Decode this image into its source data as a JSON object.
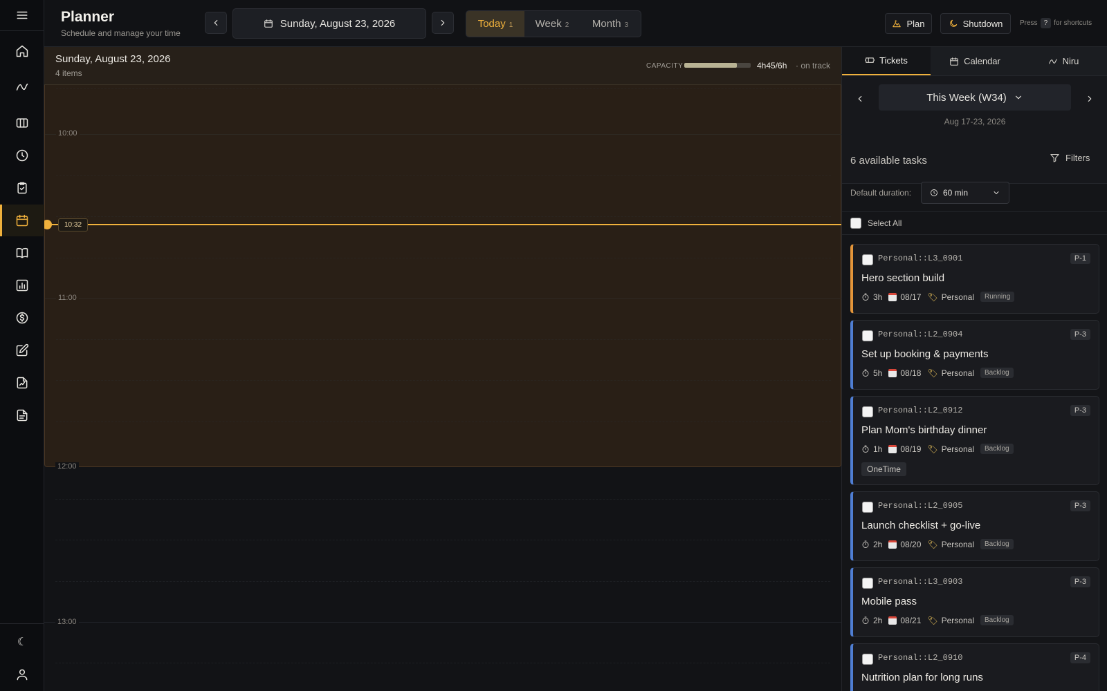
{
  "header": {
    "title": "Planner",
    "subtitle": "Schedule and manage your time",
    "current_date": "Sunday, August 23, 2026",
    "view_tabs": [
      {
        "label": "Today",
        "key": "1"
      },
      {
        "label": "Week",
        "key": "2"
      },
      {
        "label": "Month",
        "key": "3"
      }
    ],
    "plan_label": "Plan",
    "shutdown_label": "Shutdown",
    "hint_press": "Press",
    "hint_key": "?",
    "hint_suffix": "for shortcuts"
  },
  "sidebar": {
    "items": [
      {
        "icon": "home-icon"
      },
      {
        "icon": "activity-icon"
      },
      {
        "icon": "board-icon"
      },
      {
        "icon": "clock-icon"
      },
      {
        "icon": "clipboard-check-icon"
      },
      {
        "icon": "calendar-icon",
        "active": true
      },
      {
        "icon": "book-icon"
      },
      {
        "icon": "chart-icon"
      },
      {
        "icon": "dollar-icon"
      },
      {
        "icon": "edit-icon"
      },
      {
        "icon": "file-chart-icon"
      },
      {
        "icon": "document-icon"
      }
    ],
    "bottom": [
      {
        "icon": "moon-icon"
      },
      {
        "icon": "user-icon"
      }
    ]
  },
  "calendar": {
    "date": "Sunday, August 23, 2026",
    "items_count": "4 items",
    "capacity_label": "CAPACITY",
    "capacity_fraction": 0.79,
    "capacity_value": "4h45/6h",
    "capacity_status": "· on track",
    "hours": [
      "10:00",
      "11:00",
      "12:00",
      "13:00"
    ],
    "now_label": "10:32"
  },
  "panel": {
    "tabs": [
      {
        "label": "Tickets",
        "active": true
      },
      {
        "label": "Calendar"
      },
      {
        "label": "Niru"
      }
    ],
    "week_label": "This Week (W34)",
    "week_range": "Aug 17-23, 2026",
    "available": "6 available tasks",
    "filters_label": "Filters",
    "default_duration_label": "Default duration:",
    "default_duration_value": "60 min",
    "select_all": "Select All",
    "tasks": [
      {
        "id": "Personal::L3_0901",
        "priority": "P-1",
        "title": "Hero section build",
        "duration": "3h",
        "date": "08/17",
        "tag": "Personal",
        "status": "Running"
      },
      {
        "id": "Personal::L2_0904",
        "priority": "P-3",
        "title": "Set up booking & payments",
        "duration": "5h",
        "date": "08/18",
        "tag": "Personal",
        "status": "Backlog"
      },
      {
        "id": "Personal::L2_0912",
        "priority": "P-3",
        "title": "Plan Mom's birthday dinner",
        "duration": "1h",
        "date": "08/19",
        "tag": "Personal",
        "status": "Backlog",
        "extra": "OneTime"
      },
      {
        "id": "Personal::L2_0905",
        "priority": "P-3",
        "title": "Launch checklist + go-live",
        "duration": "2h",
        "date": "08/20",
        "tag": "Personal",
        "status": "Backlog"
      },
      {
        "id": "Personal::L3_0903",
        "priority": "P-3",
        "title": "Mobile pass",
        "duration": "2h",
        "date": "08/21",
        "tag": "Personal",
        "status": "Backlog"
      },
      {
        "id": "Personal::L2_0910",
        "priority": "P-4",
        "title": "Nutrition plan for long runs"
      }
    ]
  }
}
